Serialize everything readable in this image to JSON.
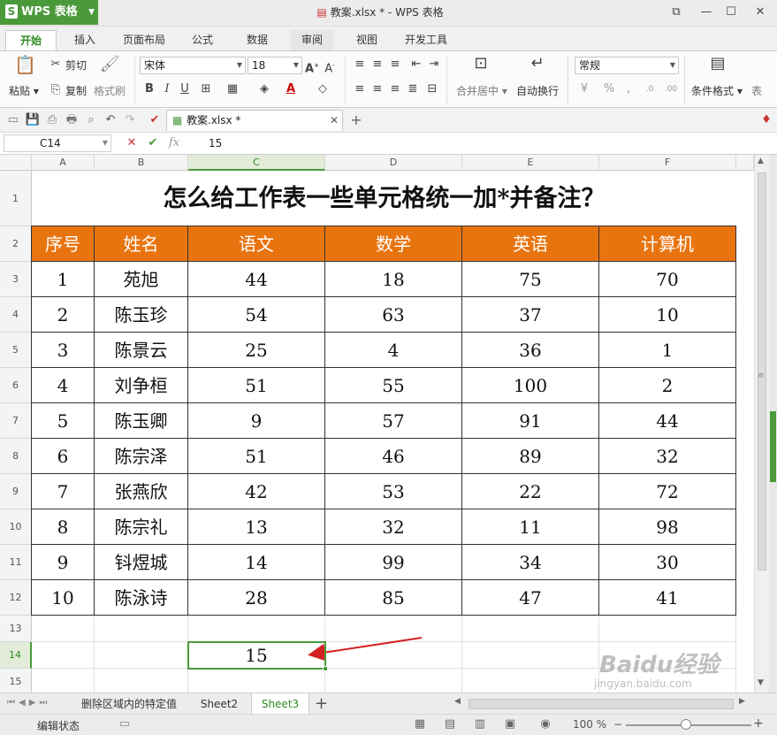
{
  "app": {
    "name": "WPS 表格",
    "window_title": "教案.xlsx * - WPS 表格"
  },
  "ribbon_tabs": [
    {
      "label": "开始",
      "active": true
    },
    {
      "label": "插入"
    },
    {
      "label": "页面布局"
    },
    {
      "label": "公式"
    },
    {
      "label": "数据"
    },
    {
      "label": "审阅"
    },
    {
      "label": "视图"
    },
    {
      "label": "开发工具"
    }
  ],
  "ribbon": {
    "cut": "剪切",
    "paste": "粘贴",
    "copy": "复制",
    "format_painter": "格式刷",
    "font_name": "宋体",
    "font_size": "18",
    "merge_center": "合并居中",
    "wrap_text": "自动换行",
    "number_format": "常规",
    "percent": "%",
    "conditional_format": "条件格式",
    "table_style": "表"
  },
  "document_tab": "教案.xlsx *",
  "formula_bar": {
    "cell_ref": "C14",
    "fx": "fx",
    "value": "15"
  },
  "columns": [
    "A",
    "B",
    "C",
    "D",
    "E",
    "F"
  ],
  "rows": [
    "1",
    "2",
    "3",
    "4",
    "5",
    "6",
    "7",
    "8",
    "9",
    "10",
    "11",
    "12",
    "13",
    "14",
    "15"
  ],
  "sheet_title": "怎么给工作表一些单元格统一加*并备注？",
  "table": {
    "headers": [
      "序号",
      "姓名",
      "语文",
      "数学",
      "英语",
      "计算机"
    ],
    "rows": [
      [
        "1",
        "苑旭",
        "44",
        "18",
        "75",
        "70"
      ],
      [
        "2",
        "陈玉珍",
        "54",
        "63",
        "37",
        "10"
      ],
      [
        "3",
        "陈景云",
        "25",
        "4",
        "36",
        "1"
      ],
      [
        "4",
        "刘争桓",
        "51",
        "55",
        "100",
        "2"
      ],
      [
        "5",
        "陈玉卿",
        "9",
        "57",
        "91",
        "44"
      ],
      [
        "6",
        "陈宗泽",
        "51",
        "46",
        "89",
        "32"
      ],
      [
        "7",
        "张燕欣",
        "42",
        "53",
        "22",
        "72"
      ],
      [
        "8",
        "陈宗礼",
        "13",
        "32",
        "11",
        "98"
      ],
      [
        "9",
        "钭煜城",
        "14",
        "99",
        "34",
        "30"
      ],
      [
        "10",
        "陈泳诗",
        "28",
        "85",
        "47",
        "41"
      ]
    ]
  },
  "selected_cell_value": "15",
  "sheet_tabs": [
    {
      "label": "删除区域内的特定值"
    },
    {
      "label": "Sheet2"
    },
    {
      "label": "Sheet3",
      "active": true
    }
  ],
  "status": {
    "mode": "编辑状态",
    "zoom": "100 %"
  },
  "watermark": {
    "brand": "Baidu经验",
    "url": "jingyan.baidu.com"
  },
  "colors": {
    "accent": "#4a9a3a",
    "header_fill": "#e8740f",
    "arrow": "#d42020"
  }
}
